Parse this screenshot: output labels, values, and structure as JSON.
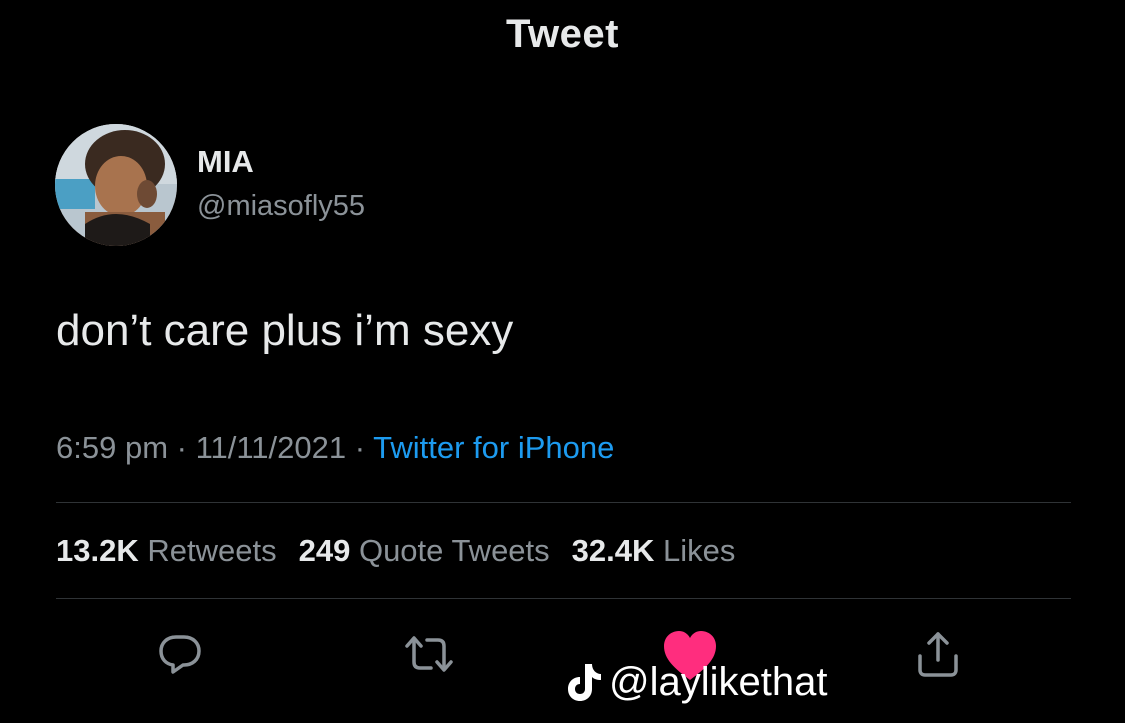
{
  "header": {
    "title": "Tweet"
  },
  "author": {
    "display_name": "MIA",
    "handle": "@miasofly55"
  },
  "tweet": {
    "text": "don’t care plus i’m sexy"
  },
  "meta": {
    "time": "6:59 pm",
    "separator1": " · ",
    "date": "11/11/2021",
    "separator2": " · ",
    "source": "Twitter for iPhone"
  },
  "stats": {
    "retweets_count": "13.2K",
    "retweets_label": "Retweets",
    "quotes_count": "249",
    "quotes_label": "Quote Tweets",
    "likes_count": "32.4K",
    "likes_label": "Likes"
  },
  "actions": [
    {
      "name": "reply",
      "icon": "speech-bubble-icon"
    },
    {
      "name": "retweet",
      "icon": "retweet-arrows-icon"
    },
    {
      "name": "like",
      "icon": "heart-icon"
    },
    {
      "name": "share",
      "icon": "share-upload-icon"
    }
  ],
  "colors": {
    "background": "#000000",
    "text": "#e7e9ea",
    "muted": "#8b9298",
    "link": "#1d9bf0",
    "heart": "#ff2d7e",
    "divider": "#2f3336"
  },
  "watermark": {
    "icon": "tiktok-note-icon",
    "text": "@laylikethat"
  }
}
